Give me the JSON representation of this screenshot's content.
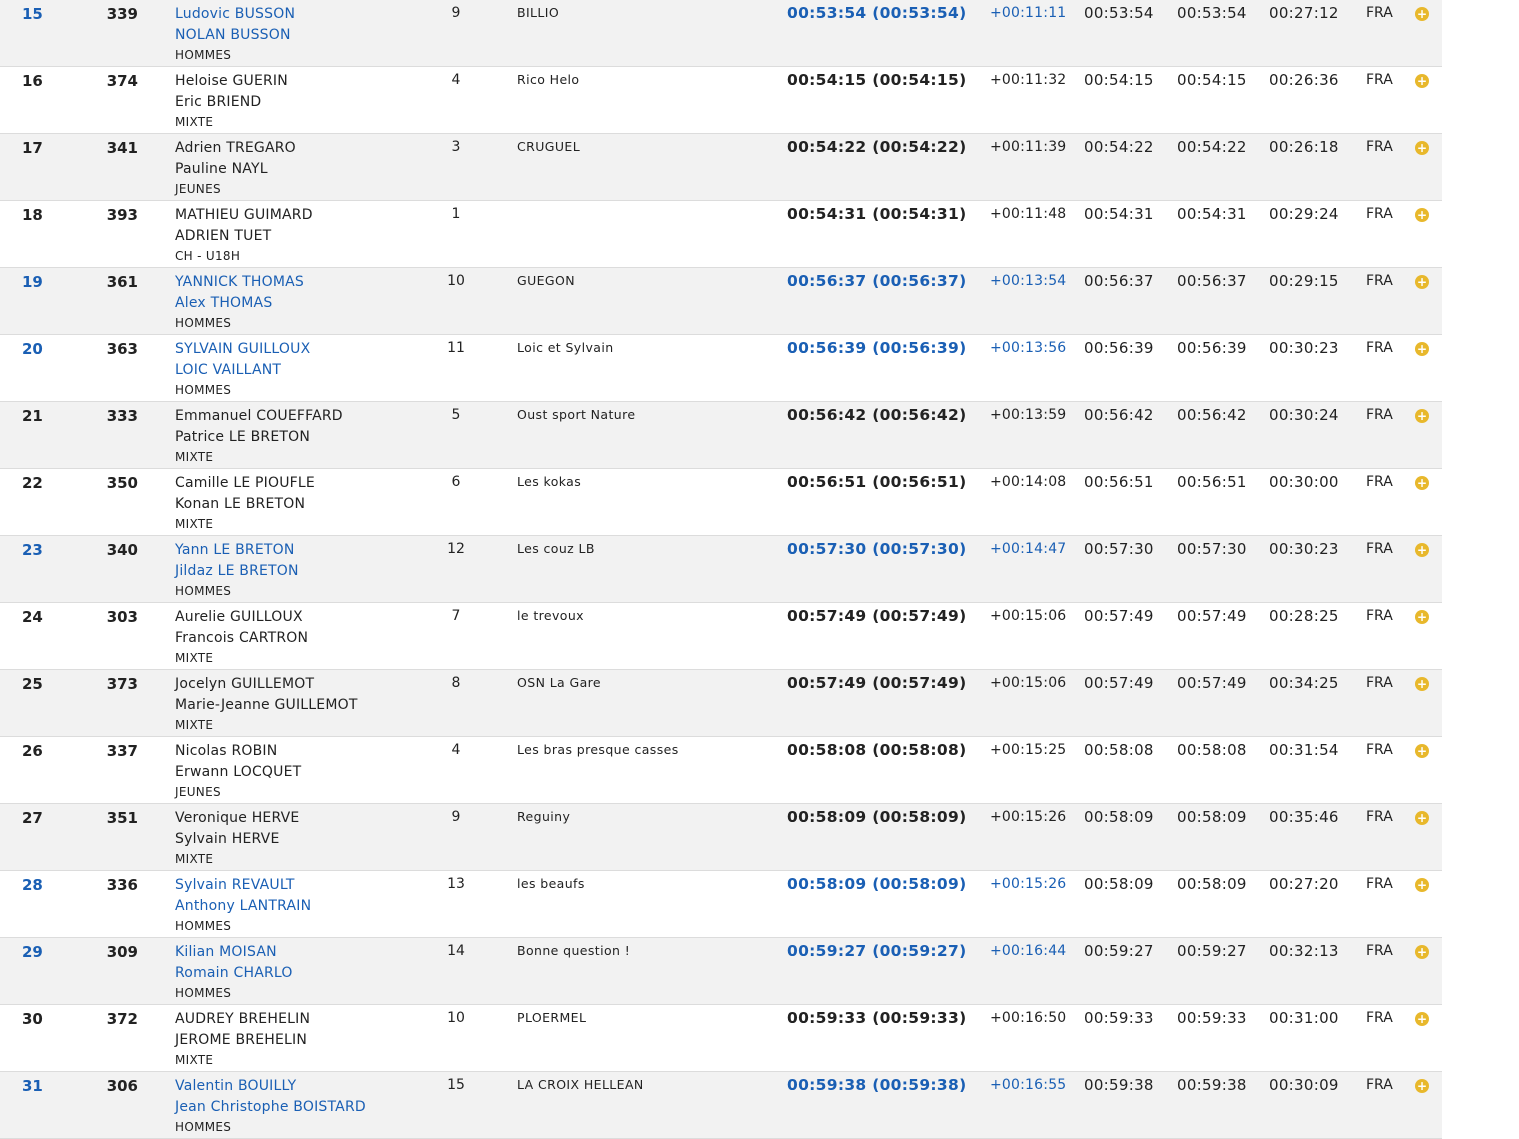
{
  "colors": {
    "highlight": "#1a5fb4",
    "more_icon": "#e8b82c",
    "row_alt": "#f2f2f2"
  },
  "rows": [
    {
      "rank": "15",
      "bib": "339",
      "runner1": "Ludovic BUSSON",
      "runner2": "NOLAN BUSSON",
      "category": "HOMMES",
      "cat_rank": "9",
      "team": "BILLIO",
      "time": "00:53:54 (00:53:54)",
      "gap": "+00:11:11",
      "t1": "00:53:54",
      "t2": "00:53:54",
      "t3": "00:27:12",
      "nat": "FRA",
      "highlight": true,
      "more_icon": "plus-circle-icon",
      "more": "+"
    },
    {
      "rank": "16",
      "bib": "374",
      "runner1": "Heloise GUERIN",
      "runner2": "Eric BRIEND",
      "category": "MIXTE",
      "cat_rank": "4",
      "team": "Rico Helo",
      "time": "00:54:15 (00:54:15)",
      "gap": "+00:11:32",
      "t1": "00:54:15",
      "t2": "00:54:15",
      "t3": "00:26:36",
      "nat": "FRA",
      "highlight": false,
      "more_icon": "plus-circle-icon",
      "more": "+"
    },
    {
      "rank": "17",
      "bib": "341",
      "runner1": "Adrien TREGARO",
      "runner2": "Pauline NAYL",
      "category": "JEUNES",
      "cat_rank": "3",
      "team": "CRUGUEL",
      "time": "00:54:22 (00:54:22)",
      "gap": "+00:11:39",
      "t1": "00:54:22",
      "t2": "00:54:22",
      "t3": "00:26:18",
      "nat": "FRA",
      "highlight": false,
      "more_icon": "plus-circle-icon",
      "more": "+"
    },
    {
      "rank": "18",
      "bib": "393",
      "runner1": "MATHIEU GUIMARD",
      "runner2": "ADRIEN TUET",
      "category": "CH - U18H",
      "cat_rank": "1",
      "team": "",
      "time": "00:54:31 (00:54:31)",
      "gap": "+00:11:48",
      "t1": "00:54:31",
      "t2": "00:54:31",
      "t3": "00:29:24",
      "nat": "FRA",
      "highlight": false,
      "more_icon": "plus-circle-icon",
      "more": "+"
    },
    {
      "rank": "19",
      "bib": "361",
      "runner1": "YANNICK THOMAS",
      "runner2": "Alex THOMAS",
      "category": "HOMMES",
      "cat_rank": "10",
      "team": "GUEGON",
      "time": "00:56:37 (00:56:37)",
      "gap": "+00:13:54",
      "t1": "00:56:37",
      "t2": "00:56:37",
      "t3": "00:29:15",
      "nat": "FRA",
      "highlight": true,
      "more_icon": "plus-circle-icon",
      "more": "+"
    },
    {
      "rank": "20",
      "bib": "363",
      "runner1": "SYLVAIN GUILLOUX",
      "runner2": "LOIC VAILLANT",
      "category": "HOMMES",
      "cat_rank": "11",
      "team": "Loic et Sylvain",
      "time": "00:56:39 (00:56:39)",
      "gap": "+00:13:56",
      "t1": "00:56:39",
      "t2": "00:56:39",
      "t3": "00:30:23",
      "nat": "FRA",
      "highlight": true,
      "more_icon": "plus-circle-icon",
      "more": "+"
    },
    {
      "rank": "21",
      "bib": "333",
      "runner1": "Emmanuel COUEFFARD",
      "runner2": "Patrice LE BRETON",
      "category": "MIXTE",
      "cat_rank": "5",
      "team": "Oust sport Nature",
      "time": "00:56:42 (00:56:42)",
      "gap": "+00:13:59",
      "t1": "00:56:42",
      "t2": "00:56:42",
      "t3": "00:30:24",
      "nat": "FRA",
      "highlight": false,
      "more_icon": "plus-circle-icon",
      "more": "+"
    },
    {
      "rank": "22",
      "bib": "350",
      "runner1": "Camille LE PIOUFLE",
      "runner2": "Konan LE BRETON",
      "category": "MIXTE",
      "cat_rank": "6",
      "team": "Les kokas",
      "time": "00:56:51 (00:56:51)",
      "gap": "+00:14:08",
      "t1": "00:56:51",
      "t2": "00:56:51",
      "t3": "00:30:00",
      "nat": "FRA",
      "highlight": false,
      "more_icon": "plus-circle-icon",
      "more": "+"
    },
    {
      "rank": "23",
      "bib": "340",
      "runner1": "Yann LE BRETON",
      "runner2": "Jildaz LE BRETON",
      "category": "HOMMES",
      "cat_rank": "12",
      "team": "Les couz LB",
      "time": "00:57:30 (00:57:30)",
      "gap": "+00:14:47",
      "t1": "00:57:30",
      "t2": "00:57:30",
      "t3": "00:30:23",
      "nat": "FRA",
      "highlight": true,
      "more_icon": "plus-circle-icon",
      "more": "+"
    },
    {
      "rank": "24",
      "bib": "303",
      "runner1": "Aurelie GUILLOUX",
      "runner2": "Francois CARTRON",
      "category": "MIXTE",
      "cat_rank": "7",
      "team": "le trevoux",
      "time": "00:57:49 (00:57:49)",
      "gap": "+00:15:06",
      "t1": "00:57:49",
      "t2": "00:57:49",
      "t3": "00:28:25",
      "nat": "FRA",
      "highlight": false,
      "more_icon": "plus-circle-icon",
      "more": "+"
    },
    {
      "rank": "25",
      "bib": "373",
      "runner1": "Jocelyn GUILLEMOT",
      "runner2": "Marie-Jeanne GUILLEMOT",
      "category": "MIXTE",
      "cat_rank": "8",
      "team": "OSN La Gare",
      "time": "00:57:49 (00:57:49)",
      "gap": "+00:15:06",
      "t1": "00:57:49",
      "t2": "00:57:49",
      "t3": "00:34:25",
      "nat": "FRA",
      "highlight": false,
      "more_icon": "plus-circle-icon",
      "more": "+"
    },
    {
      "rank": "26",
      "bib": "337",
      "runner1": "Nicolas ROBIN",
      "runner2": "Erwann LOCQUET",
      "category": "JEUNES",
      "cat_rank": "4",
      "team": "Les bras presque casses",
      "time": "00:58:08 (00:58:08)",
      "gap": "+00:15:25",
      "t1": "00:58:08",
      "t2": "00:58:08",
      "t3": "00:31:54",
      "nat": "FRA",
      "highlight": false,
      "more_icon": "plus-circle-icon",
      "more": "+"
    },
    {
      "rank": "27",
      "bib": "351",
      "runner1": "Veronique HERVE",
      "runner2": "Sylvain HERVE",
      "category": "MIXTE",
      "cat_rank": "9",
      "team": "Reguiny",
      "time": "00:58:09 (00:58:09)",
      "gap": "+00:15:26",
      "t1": "00:58:09",
      "t2": "00:58:09",
      "t3": "00:35:46",
      "nat": "FRA",
      "highlight": false,
      "more_icon": "plus-circle-icon",
      "more": "+"
    },
    {
      "rank": "28",
      "bib": "336",
      "runner1": "Sylvain REVAULT",
      "runner2": "Anthony LANTRAIN",
      "category": "HOMMES",
      "cat_rank": "13",
      "team": "les beaufs",
      "time": "00:58:09 (00:58:09)",
      "gap": "+00:15:26",
      "t1": "00:58:09",
      "t2": "00:58:09",
      "t3": "00:27:20",
      "nat": "FRA",
      "highlight": true,
      "more_icon": "plus-circle-icon",
      "more": "+"
    },
    {
      "rank": "29",
      "bib": "309",
      "runner1": "Kilian MOISAN",
      "runner2": "Romain CHARLO",
      "category": "HOMMES",
      "cat_rank": "14",
      "team": "Bonne question !",
      "time": "00:59:27 (00:59:27)",
      "gap": "+00:16:44",
      "t1": "00:59:27",
      "t2": "00:59:27",
      "t3": "00:32:13",
      "nat": "FRA",
      "highlight": true,
      "more_icon": "plus-circle-icon",
      "more": "+"
    },
    {
      "rank": "30",
      "bib": "372",
      "runner1": "AUDREY BREHELIN",
      "runner2": "JEROME BREHELIN",
      "category": "MIXTE",
      "cat_rank": "10",
      "team": "PLOERMEL",
      "time": "00:59:33 (00:59:33)",
      "gap": "+00:16:50",
      "t1": "00:59:33",
      "t2": "00:59:33",
      "t3": "00:31:00",
      "nat": "FRA",
      "highlight": false,
      "more_icon": "plus-circle-icon",
      "more": "+"
    },
    {
      "rank": "31",
      "bib": "306",
      "runner1": "Valentin BOUILLY",
      "runner2": "Jean Christophe BOISTARD",
      "category": "HOMMES",
      "cat_rank": "15",
      "team": "LA CROIX HELLEAN",
      "time": "00:59:38 (00:59:38)",
      "gap": "+00:16:55",
      "t1": "00:59:38",
      "t2": "00:59:38",
      "t3": "00:30:09",
      "nat": "FRA",
      "highlight": true,
      "more_icon": "plus-circle-icon",
      "more": "+"
    }
  ]
}
